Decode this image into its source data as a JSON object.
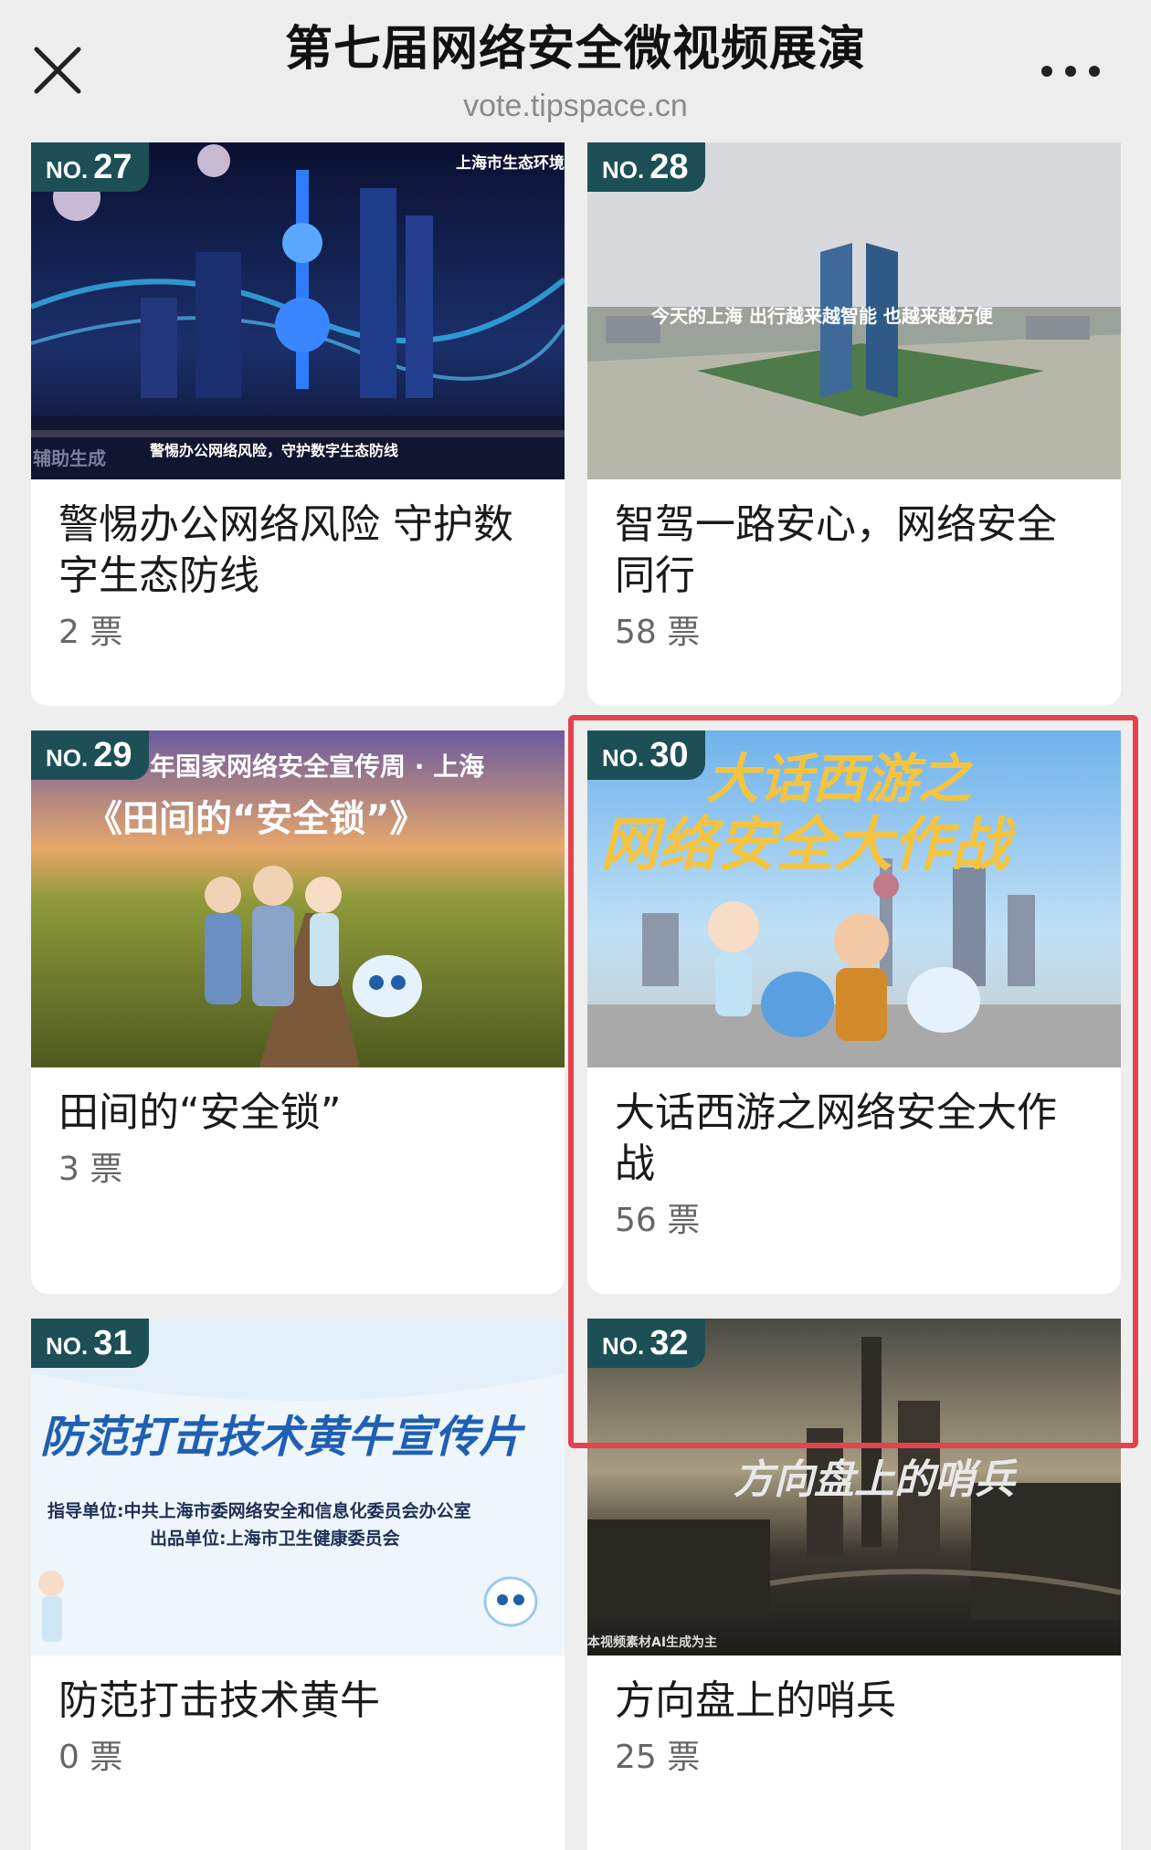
{
  "header": {
    "title": "第七届网络安全微视频展演",
    "subtitle": "vote.tipspace.cn",
    "close_icon": "close-icon",
    "more_icon": "more-horizontal-icon"
  },
  "vote_unit": "票",
  "cards": [
    {
      "no_prefix": "NO.",
      "number": "27",
      "title": "警惕办公网络风险 守护数字生态防线",
      "votes": "2",
      "vote_unit": "票",
      "thumb_text": [
        "上海市生态环境",
        "警惕办公网络风险，守护数字生态防线",
        "辅助生成"
      ]
    },
    {
      "no_prefix": "NO.",
      "number": "28",
      "title": "智驾一路安心，网络安全同行",
      "votes": "58",
      "vote_unit": "票",
      "thumb_text": [
        "今天的上海  出行越来越智能  也越来越方便"
      ]
    },
    {
      "no_prefix": "NO.",
      "number": "29",
      "title": "田间的“安全锁”",
      "votes": "3",
      "vote_unit": "票",
      "thumb_text": [
        "年国家网络安全宣传周 · 上海",
        "《田间的“安全锁”》"
      ]
    },
    {
      "no_prefix": "NO.",
      "number": "30",
      "title": "大话西游之网络安全大作战",
      "votes": "56",
      "vote_unit": "票",
      "thumb_text": [
        "大话西游之",
        "网络安全大作战"
      ]
    },
    {
      "no_prefix": "NO.",
      "number": "31",
      "title": "防范打击技术黄牛",
      "votes": "0",
      "vote_unit": "票",
      "thumb_text": [
        "防范打击技术黄牛宣传片",
        "指导单位:中共上海市委网络安全和信息化委员会办公室",
        "出品单位:上海市卫生健康委员会"
      ]
    },
    {
      "no_prefix": "NO.",
      "number": "32",
      "title": "方向盘上的哨兵",
      "votes": "25",
      "vote_unit": "票",
      "thumb_text": [
        "方向盘上的哨兵",
        "本视频素材AI生成为主"
      ]
    }
  ],
  "colors": {
    "badge": "#1d4f57",
    "highlight": "#e4434d",
    "background": "#eeeeee"
  }
}
